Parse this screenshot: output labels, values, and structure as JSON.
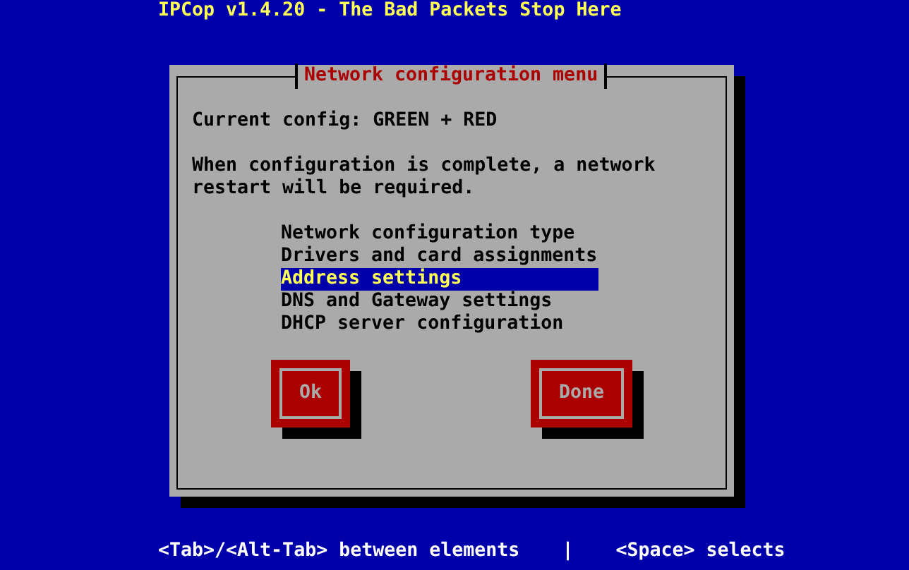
{
  "screen_title": "IPCop v1.4.20 - The Bad Packets Stop Here",
  "dialog": {
    "title": "Network configuration menu",
    "current_config": "Current config: GREEN + RED",
    "message": "When configuration is complete, a network restart will be required.",
    "menu_items": [
      {
        "label": "Network configuration type",
        "selected": false
      },
      {
        "label": "Drivers and card assignments",
        "selected": false
      },
      {
        "label": "Address settings",
        "selected": true
      },
      {
        "label": "DNS and Gateway settings",
        "selected": false
      },
      {
        "label": "DHCP server configuration",
        "selected": false
      }
    ],
    "buttons": [
      "Ok",
      "Done"
    ]
  },
  "help_line": [
    "<Tab>/<Alt-Tab> between elements",
    "|",
    "<Space> selects"
  ]
}
